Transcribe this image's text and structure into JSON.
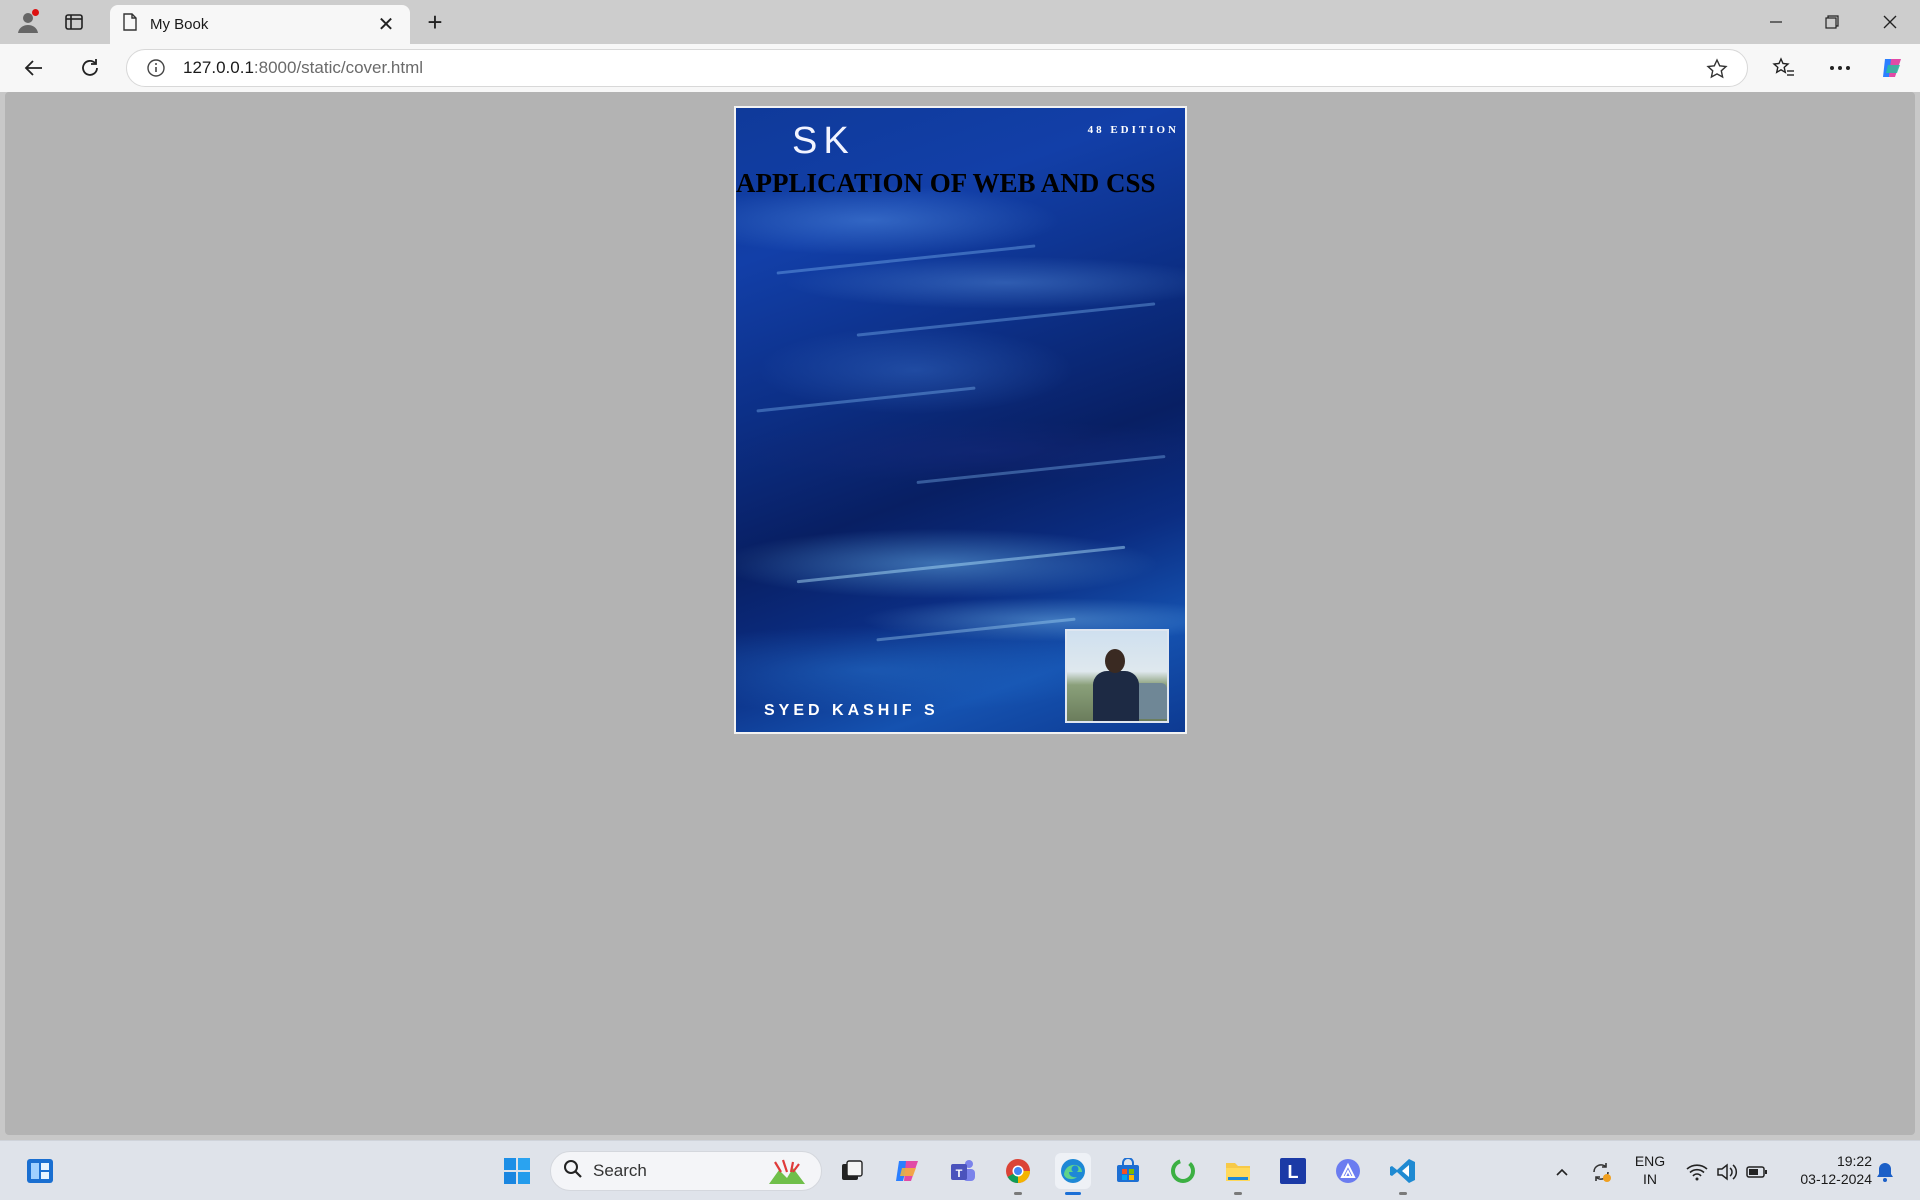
{
  "browser": {
    "tab_title": "My Book",
    "url_host": "127.0.0.1",
    "url_path": ":8000/static/cover.html"
  },
  "cover": {
    "monogram": "SK",
    "edition": "48 EDITION",
    "title": "APPLICATION OF WEB AND CSS",
    "author": "SYED KASHIF S",
    "background_color": "#0c2f86"
  },
  "taskbar": {
    "search_label": "Search",
    "language_line1": "ENG",
    "language_line2": "IN",
    "time": "19:22",
    "date": "03-12-2024",
    "apps": [
      "start-icon",
      "search-icon",
      "task-view-icon",
      "copilot-icon",
      "teams-icon",
      "chrome-icon",
      "edge-icon",
      "store-icon",
      "refresh-app-icon",
      "file-explorer-icon",
      "l-app-icon",
      "triangle-app-icon",
      "vscode-icon"
    ]
  }
}
